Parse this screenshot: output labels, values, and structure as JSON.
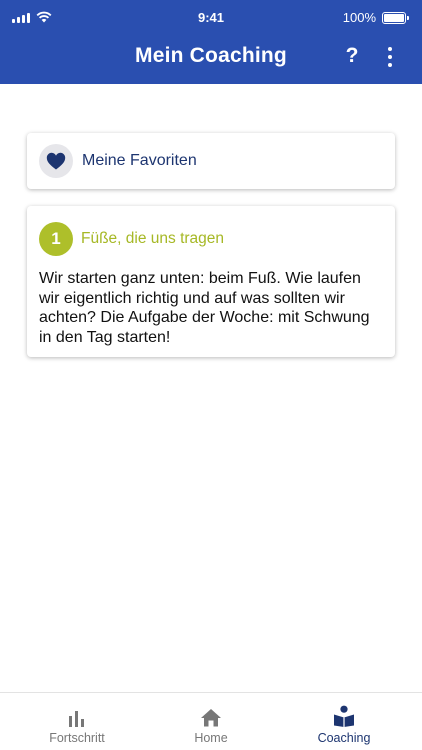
{
  "status_bar": {
    "time": "9:41",
    "battery": "100%"
  },
  "header": {
    "title": "Mein Coaching",
    "help_label": "?"
  },
  "favorites": {
    "label": "Meine Favoriten"
  },
  "lesson": {
    "number": "1",
    "title": "Füße, die uns tragen",
    "description": "Wir starten ganz unten: beim Fuß. Wie laufen wir eigentlich richtig und auf was sollten wir achten? Die Aufgabe der Woche: mit Schwung in den Tag starten!"
  },
  "tabs": [
    {
      "label": "Fortschritt",
      "icon": "bar-chart-icon",
      "active": false
    },
    {
      "label": "Home",
      "icon": "home-icon",
      "active": false
    },
    {
      "label": "Coaching",
      "icon": "reading-person-icon",
      "active": true
    }
  ],
  "colors": {
    "header": "#2a4fb0",
    "accent_green": "#aebf2a",
    "navy": "#1d3570",
    "inactive": "#777777"
  }
}
